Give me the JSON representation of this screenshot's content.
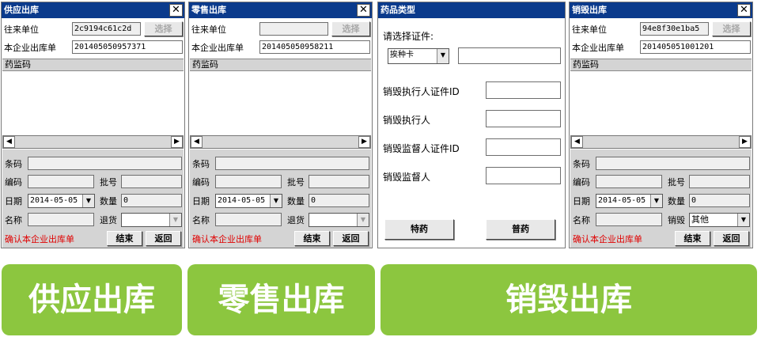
{
  "panel1": {
    "title": "供应出库",
    "label_unit": "往来单位",
    "unit_value": "2c9194c61c2d",
    "select_label": "选择",
    "label_order": "本企业出库单",
    "order_value": "201405050957371",
    "list_header": "药监码",
    "label_barcode": "条码",
    "label_code": "编码",
    "label_batch": "批号",
    "label_date": "日期",
    "date_value": "2014-05-05",
    "label_qty": "数量",
    "qty_value": "0",
    "label_name": "名称",
    "label_return": "退货",
    "confirm_text": "确认本企业出库单",
    "finish_label": "结束",
    "back_label": "返回"
  },
  "panel2": {
    "title": "零售出库",
    "label_unit": "往来单位",
    "unit_value": "",
    "select_label": "选择",
    "label_order": "本企业出库单",
    "order_value": "201405050958211",
    "list_header": "药监码",
    "label_barcode": "条码",
    "label_code": "编码",
    "label_batch": "批号",
    "label_date": "日期",
    "date_value": "2014-05-05",
    "label_qty": "数量",
    "qty_value": "0",
    "label_name": "名称",
    "label_return": "退货",
    "confirm_text": "确认本企业出库单",
    "finish_label": "结束",
    "back_label": "返回"
  },
  "panel3": {
    "title": "药品类型",
    "choose_cert": "请选择证件:",
    "cert_type": "挨种卡",
    "label_exec_id": "销毁执行人证件ID",
    "label_exec": "销毁执行人",
    "label_sup_id": "销毁监督人证件ID",
    "label_sup": "销毁监督人",
    "special_btn": "特药",
    "normal_btn": "普药"
  },
  "panel4": {
    "title": "销毁出库",
    "label_unit": "往来单位",
    "unit_value": "94e8f30e1ba5",
    "select_label": "选择",
    "label_order": "本企业出库单",
    "order_value": "201405051001201",
    "list_header": "药监码",
    "label_barcode": "条码",
    "label_code": "编码",
    "label_batch": "批号",
    "label_date": "日期",
    "date_value": "2014-05-05",
    "label_qty": "数量",
    "qty_value": "0",
    "label_name": "名称",
    "label_destroy": "销毁",
    "destroy_value": "其他",
    "confirm_text": "确认本企业出库单",
    "finish_label": "结束",
    "back_label": "返回"
  },
  "captions": {
    "supply": "供应出库",
    "retail": "零售出库",
    "destroy": "销毁出库"
  },
  "colors": {
    "titlebar": "#0a3a8c",
    "caption_bg": "#8cc63f",
    "confirm_red": "#e00000"
  }
}
